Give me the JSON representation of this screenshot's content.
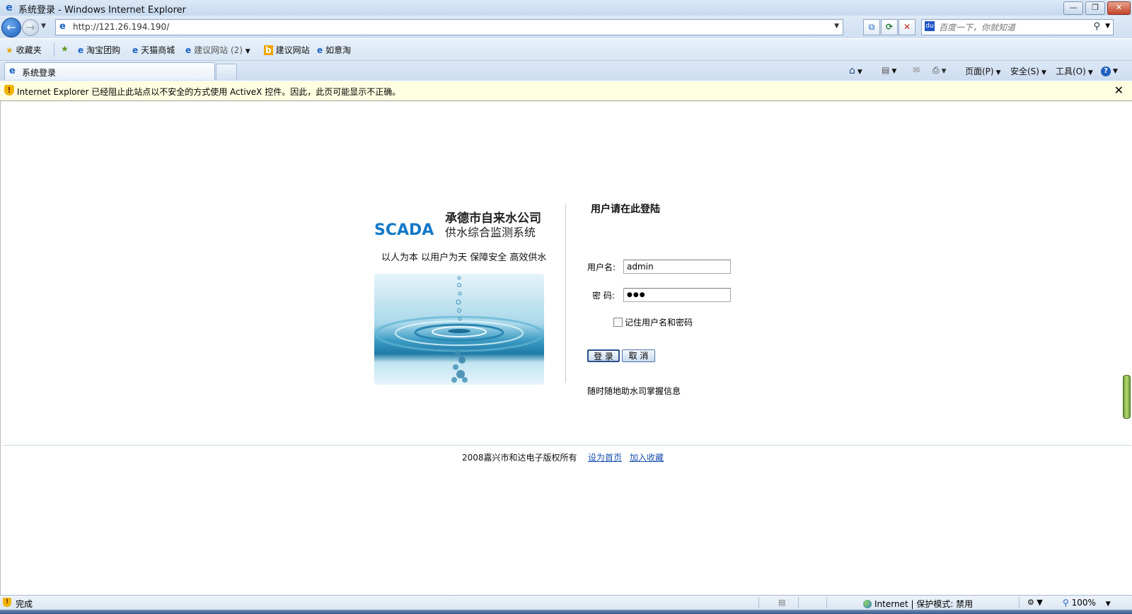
{
  "window": {
    "title": "系统登录 - Windows Internet Explorer",
    "min_glyph": "—",
    "max_glyph": "❐",
    "close_glyph": "✕"
  },
  "address": {
    "url": "http://121.26.194.190/",
    "search_placeholder": "百度一下，你就知道"
  },
  "favorites": {
    "favorites_label": "收藏夹",
    "items": [
      {
        "label": "淘宝团购"
      },
      {
        "label": "天猫商城"
      },
      {
        "label": "建议网站 (2)"
      },
      {
        "label": "建议网站"
      },
      {
        "label": "如意淘"
      }
    ]
  },
  "tabs": {
    "active_label": "系统登录"
  },
  "commandbar": {
    "page_label": "页面(P)",
    "safety_label": "安全(S)",
    "tools_label": "工具(O)"
  },
  "infobar": {
    "message": "Internet Explorer 已经阻止此站点以不安全的方式使用 ActiveX 控件。因此，此页可能显示不正确。"
  },
  "page": {
    "company": "承德市自来水公司",
    "logo_text": "SCADA",
    "system_name": "供水综合监测系统",
    "slogan": "以人为本 以用户为天 保障安全 高效供水",
    "login_title": "用户请在此登陆",
    "username_label": "用户名:",
    "username_value": "admin",
    "password_label": "密  码:",
    "password_dots": "●●●",
    "remember_label": "记住用户名和密码",
    "login_button": "登 录",
    "cancel_button": "取 消",
    "tagline": "随时随地助水司掌握信息",
    "copyright": "2008嘉兴市和达电子版权所有",
    "set_home": "设为首页",
    "add_favorite": "加入收藏"
  },
  "status": {
    "text": "完成",
    "zone": "Internet | 保护模式: 禁用",
    "zoom": "100%"
  }
}
